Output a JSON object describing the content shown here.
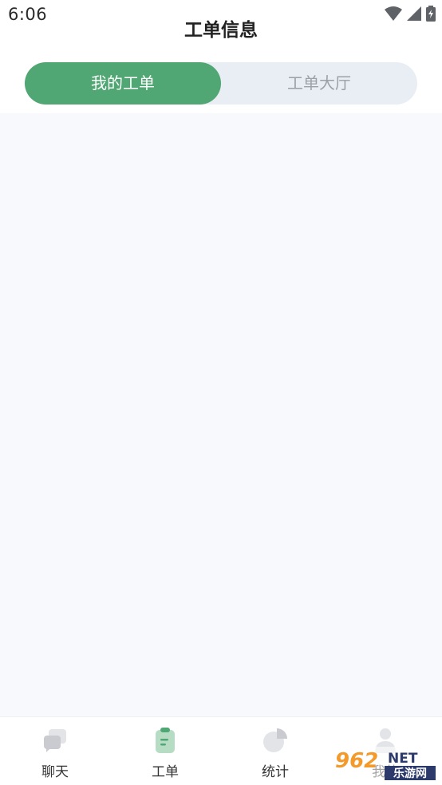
{
  "status_bar": {
    "time": "6:06",
    "icons": [
      "wifi-icon",
      "signal-icon",
      "battery-charging-icon"
    ]
  },
  "header": {
    "title": "工单信息"
  },
  "segments": {
    "active": "我的工单",
    "inactive": "工单大厅"
  },
  "tabs": [
    {
      "label": "聊天",
      "icon": "chat-icon",
      "active": false
    },
    {
      "label": "工单",
      "icon": "clipboard-icon",
      "active": true
    },
    {
      "label": "统计",
      "icon": "pie-chart-icon",
      "active": false
    },
    {
      "label": "我的",
      "icon": "person-icon",
      "active": false
    }
  ],
  "watermark": {
    "logo_text": "962",
    "net_text": "NET",
    "cn_text": "乐游网"
  },
  "colors": {
    "accent": "#51a774",
    "segment_bg": "#e9eef4",
    "content_bg": "#f7f9fd",
    "icon_gray": "#c9cbd0"
  }
}
